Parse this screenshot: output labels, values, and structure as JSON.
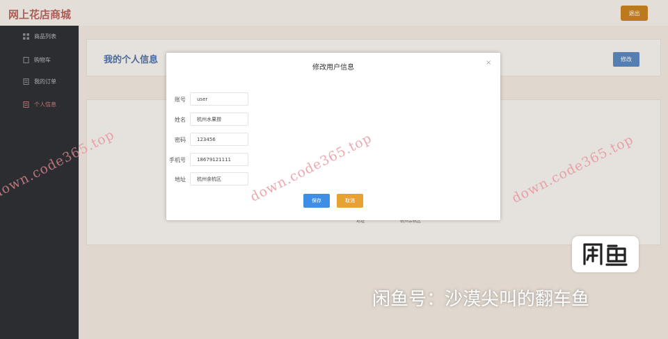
{
  "header": {
    "brand": "网上花店商城",
    "logout_label": "退出"
  },
  "sidebar": {
    "items": [
      {
        "label": "商品列表",
        "icon": "grid-icon"
      },
      {
        "label": "购物车",
        "icon": "cart-icon"
      },
      {
        "label": "我的订单",
        "icon": "document-icon"
      },
      {
        "label": "个人信息",
        "icon": "profile-icon",
        "active": true
      }
    ]
  },
  "profile_card": {
    "title": "我的个人信息",
    "edit_label": "修改"
  },
  "background_fragments": [
    "地址",
    "杭州余杭区"
  ],
  "modal": {
    "title": "修改用户信息",
    "fields": [
      {
        "label": "账号",
        "value": "user"
      },
      {
        "label": "姓名",
        "value": "杭州水果捞"
      },
      {
        "label": "密码",
        "value": "123456"
      },
      {
        "label": "手机号",
        "value": "18679121111"
      },
      {
        "label": "地址",
        "value": "杭州余杭区"
      }
    ],
    "save_label": "保存",
    "cancel_label": "取消"
  },
  "watermark": {
    "text": "down.code365.top"
  },
  "overlay_caption": {
    "text": "闲鱼号：沙漠尖叫的翻车鱼",
    "logo_text": "闲鱼"
  },
  "colors": {
    "brand": "#b9615b",
    "primary": "#3f8ee6",
    "warning": "#e8a233",
    "sidebar": "#2c2e31"
  }
}
